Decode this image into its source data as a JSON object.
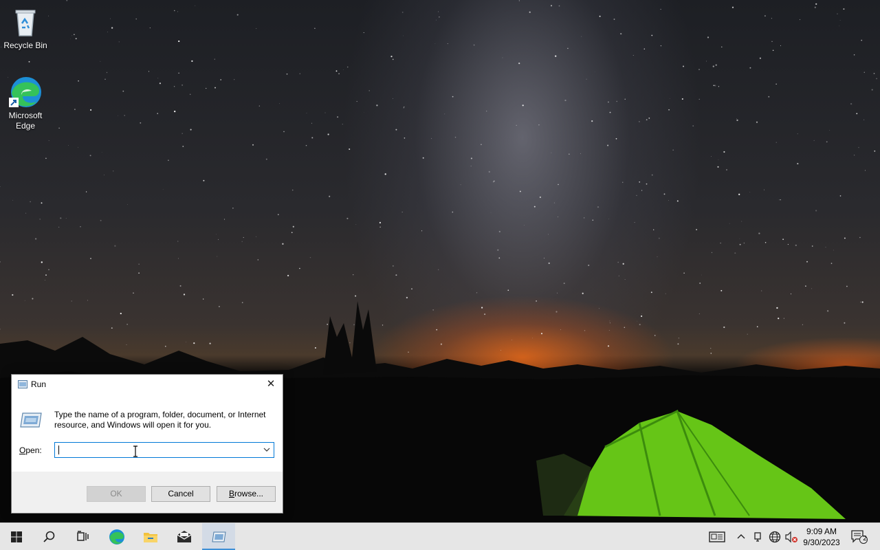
{
  "desktop": {
    "icons": [
      {
        "label": "Recycle Bin",
        "icon": "recycle-bin-icon"
      },
      {
        "label": "Microsoft Edge",
        "icon": "edge-icon"
      }
    ]
  },
  "run_dialog": {
    "title": "Run",
    "close_label": "✕",
    "description": "Type the name of a program, folder, document, or Internet resource, and Windows will open it for you.",
    "open_label_prefix": "O",
    "open_label_rest": "pen:",
    "open_value": "",
    "buttons": {
      "ok": "OK",
      "cancel": "Cancel",
      "browse_prefix": "B",
      "browse_rest": "rowse..."
    },
    "ok_enabled": false
  },
  "taskbar": {
    "pinned": [
      "start-icon",
      "search-icon",
      "task-view-icon",
      "edge-icon",
      "file-explorer-icon",
      "mail-icon",
      "run-icon"
    ],
    "active": "run-icon",
    "tray": {
      "icons": [
        "news-icon",
        "chevron-up-icon",
        "meet-icon",
        "network-icon",
        "volume-muted-icon",
        "notification-icon"
      ],
      "notification_count": "2"
    },
    "clock": {
      "time": "9:09 AM",
      "date": "9/30/2023"
    }
  },
  "colors": {
    "accent": "#0078d7",
    "taskbar": "#e6e6e6",
    "dialog_footer": "#f0f0f0"
  }
}
